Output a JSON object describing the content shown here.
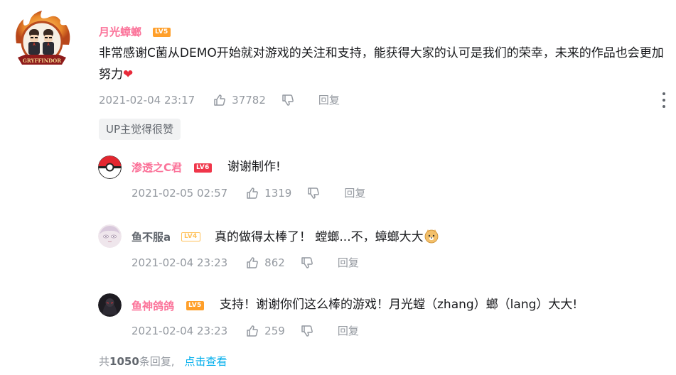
{
  "main_comment": {
    "username": "月光蟑螂",
    "level": "LV5",
    "avatar_badge": "GRYFFINDOR",
    "text": "非常感谢C菌从DEMO开始就对游戏的关注和支持，能获得大家的认可是我们的荣幸，未来的作品也会更加努力",
    "emoji": "❤",
    "time": "2021-02-04 23:17",
    "likes": "37782",
    "reply_label": "回复",
    "up_tag": "UP主觉得很赞"
  },
  "replies": [
    {
      "username": "渗透之C君",
      "level": "LV6",
      "text": "谢谢制作!",
      "time": "2021-02-05 02:57",
      "likes": "1319",
      "reply_label": "回复"
    },
    {
      "username": "鱼不服a",
      "level": "LV4",
      "text": "真的做得太棒了！ 螳螂...不，蟑螂大大",
      "emoji": "🐶",
      "time": "2021-02-04 23:23",
      "likes": "862",
      "reply_label": "回复"
    },
    {
      "username": "鱼神鸽鸽",
      "level": "LV5",
      "text": "支持！谢谢你们这么棒的游戏！月光螳（zhang）螂（lang）大大!",
      "time": "2021-02-04 23:23",
      "likes": "259",
      "reply_label": "回复"
    }
  ],
  "footer": {
    "prefix": "共",
    "count": "1050",
    "suffix": "条回复,",
    "view_link": "点击查看"
  },
  "colors": {
    "username_pink": "#fb7299",
    "meta_gray": "#9499a0",
    "link_blue": "#00aeec",
    "heart_red": "#e82a3a"
  }
}
